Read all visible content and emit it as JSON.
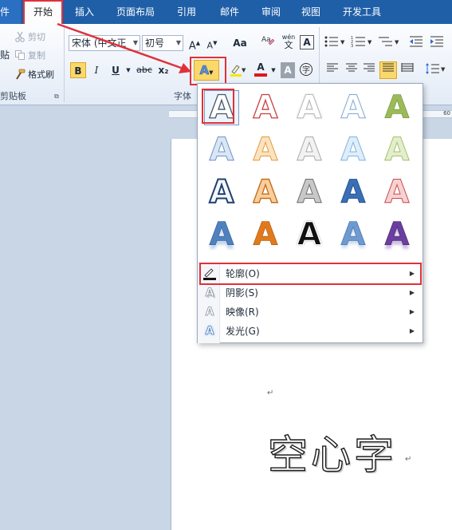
{
  "tabs": {
    "file": "件",
    "home": "开始",
    "insert": "插入",
    "page_layout": "页面布局",
    "references": "引用",
    "mailings": "邮件",
    "review": "审阅",
    "view": "视图",
    "developer": "开发工具"
  },
  "clipboard": {
    "paste_fragment": "贴",
    "cut": "剪切",
    "copy": "复制",
    "format_painter": "格式刷",
    "group_label": "剪贴板"
  },
  "font": {
    "font_name": "宋体 (中文正",
    "font_size": "初号",
    "group_label": "字体",
    "bold": "B",
    "italic": "I",
    "underline": "U",
    "strike": "abc",
    "subscript": "x₂",
    "change_case": "Aa",
    "wen": "wén",
    "char_border": "A",
    "font_color": "A",
    "char_shade": "A",
    "grow": "A",
    "shrink": "A",
    "text_effect": "A"
  },
  "text_effects_menu": {
    "outline": "轮廓(O)",
    "shadow": "阴影(S)",
    "reflection": "映像(R)",
    "glow": "发光(G)"
  },
  "ruler": {
    "mark": "60"
  },
  "document": {
    "hollow_text": "空心字",
    "para_mark": "↵"
  },
  "colors": {
    "highlight_red": "#e0313a",
    "tab_blue": "#1f5fa8",
    "selected_yellow": "#fbd86a"
  }
}
